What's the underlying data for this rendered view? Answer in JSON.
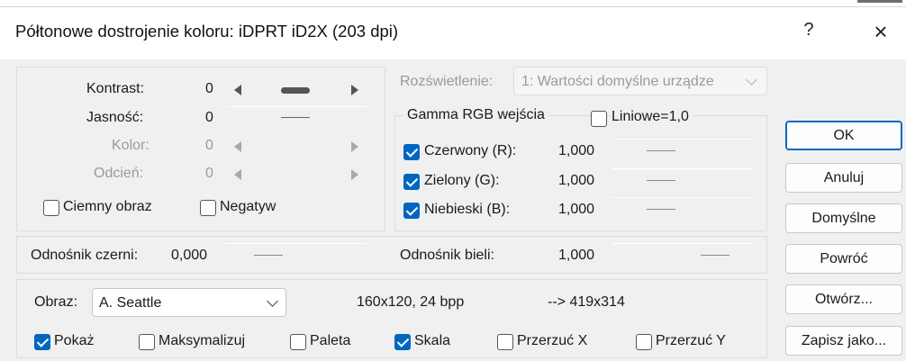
{
  "window": {
    "title": "Półtonowe dostrojenie koloru: iDPRT iD2X (203 dpi)",
    "help_label": "?",
    "close_label": "×"
  },
  "adjust": {
    "contrast": {
      "label": "Kontrast:",
      "value": "0"
    },
    "brightness": {
      "label": "Jasność:",
      "value": "0"
    },
    "color": {
      "label": "Kolor:",
      "value": "0"
    },
    "tint": {
      "label": "Odcień:",
      "value": "0"
    },
    "dark_image": {
      "label": "Ciemny obraz",
      "checked": false
    },
    "negative": {
      "label": "Negatyw",
      "checked": false
    }
  },
  "illuminant": {
    "label": "Rozświetlenie:",
    "selected": "1: Wartości domyślne urządze"
  },
  "gamma": {
    "title": "Gamma RGB wejścia",
    "linear": {
      "label": "Liniowe=1,0",
      "checked": false
    },
    "channels": [
      {
        "label": "Czerwony (R):",
        "value": "1,000",
        "checked": true
      },
      {
        "label": "Zielony (G):",
        "value": "1,000",
        "checked": true
      },
      {
        "label": "Niebieski (B):",
        "value": "1,000",
        "checked": true
      }
    ]
  },
  "reference": {
    "black_label": "Odnośnik czerni:",
    "black_value": "0,000",
    "white_label": "Odnośnik bieli:",
    "white_value": "1,000"
  },
  "image": {
    "label": "Obraz:",
    "selected": "A. Seattle",
    "info": "160x120, 24 bpp",
    "output": "--> 419x314",
    "options": [
      {
        "label": "Pokaż",
        "checked": true
      },
      {
        "label": "Maksymalizuj",
        "checked": false
      },
      {
        "label": "Paleta",
        "checked": false
      },
      {
        "label": "Skala",
        "checked": true
      },
      {
        "label": "Przerzuć X",
        "checked": false
      },
      {
        "label": "Przerzuć Y",
        "checked": false
      }
    ]
  },
  "buttons": {
    "ok": "OK",
    "cancel": "Anuluj",
    "defaults": "Domyślne",
    "revert": "Powróć",
    "open": "Otwórz...",
    "save_as": "Zapisz jako..."
  },
  "colors": {
    "accent": "#0067c0",
    "client_bg": "#f0f0f0"
  }
}
